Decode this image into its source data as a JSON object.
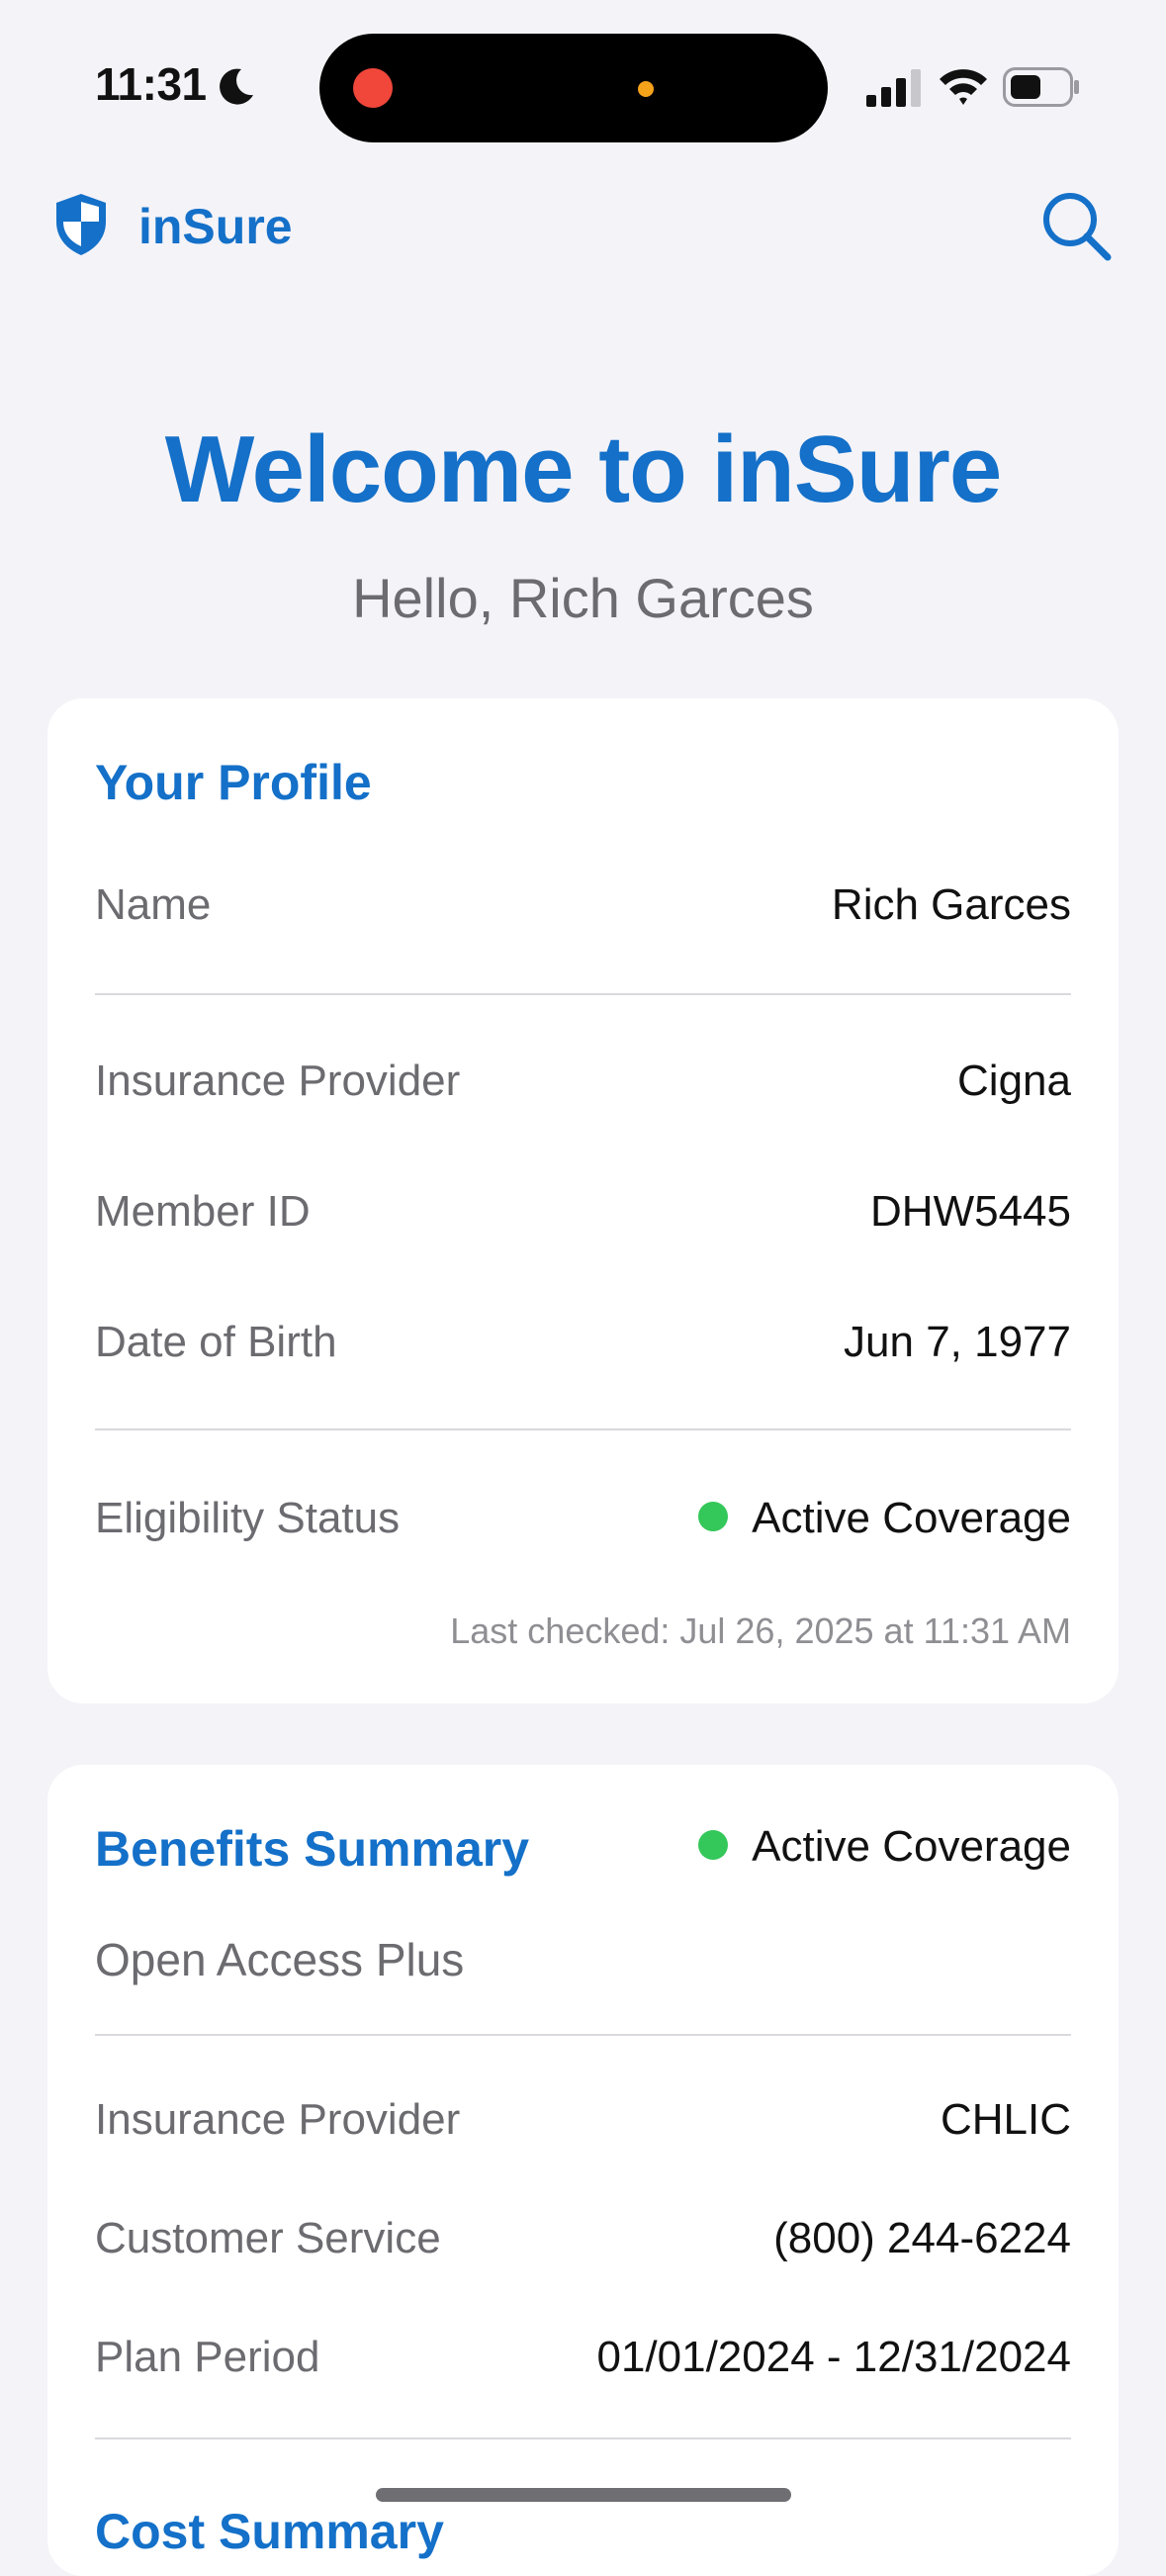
{
  "status_bar": {
    "time": "11:31"
  },
  "nav": {
    "app_name": "inSure",
    "brand_color": "#1470C8"
  },
  "hero": {
    "title": "Welcome to inSure",
    "greeting": "Hello, Rich Garces"
  },
  "profile": {
    "title": "Your Profile",
    "rows": [
      {
        "label": "Name",
        "value": "Rich Garces"
      },
      {
        "label": "Insurance Provider",
        "value": "Cigna"
      },
      {
        "label": "Member ID",
        "value": "DHW5445"
      },
      {
        "label": "Date of Birth",
        "value": "Jun 7, 1977"
      }
    ],
    "eligibility": {
      "label": "Eligibility Status",
      "value": "Active Coverage",
      "status_color": "#34C759"
    },
    "last_checked": "Last checked: Jul 26, 2025 at 11:31 AM"
  },
  "benefits": {
    "title": "Benefits Summary",
    "status": "Active Coverage",
    "plan_name": "Open Access Plus",
    "rows": [
      {
        "label": "Insurance Provider",
        "value": "CHLIC"
      },
      {
        "label": "Customer Service",
        "value": "(800) 244-6224"
      },
      {
        "label": "Plan Period",
        "value": "01/01/2024 - 12/31/2024"
      }
    ],
    "cost_summary_title": "Cost Summary"
  }
}
